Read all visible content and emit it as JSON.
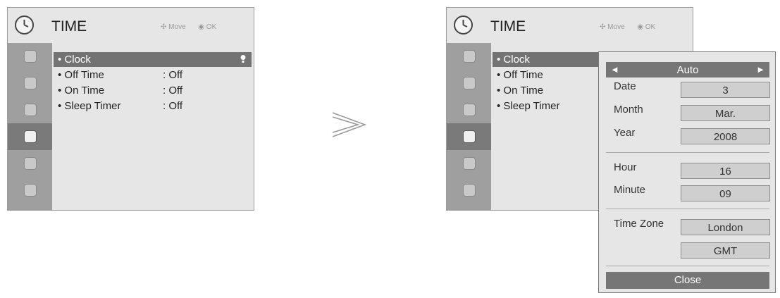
{
  "menu": {
    "title": "TIME",
    "hint_move": "Move",
    "hint_ok": "OK",
    "items": [
      {
        "label": "Clock",
        "value": ""
      },
      {
        "label": "Off Time",
        "value": ": Off"
      },
      {
        "label": "On Time",
        "value": ": Off"
      },
      {
        "label": "Sleep Timer",
        "value": ": Off"
      }
    ],
    "side_tabs": [
      "setup-icon",
      "picture-icon",
      "audio-icon",
      "time-icon",
      "lock-icon",
      "input-icon"
    ],
    "selected_tab": "time-icon",
    "selected_item": "Clock"
  },
  "clock_popup": {
    "mode_left": "◄",
    "mode": "Auto",
    "mode_right": "►",
    "fields": [
      {
        "label": "Date",
        "value": "3"
      },
      {
        "label": "Month",
        "value": "Mar."
      },
      {
        "label": "Year",
        "value": "2008"
      },
      {
        "label": "Hour",
        "value": "16"
      },
      {
        "label": "Minute",
        "value": "09"
      },
      {
        "label": "Time Zone",
        "value": "London"
      },
      {
        "label": "",
        "value": "GMT"
      }
    ],
    "close_label": "Close"
  },
  "colors": {
    "panel_bg": "#e6e6e6",
    "sidebar": "#9f9f9f",
    "highlight": "#737373",
    "text": "#222222"
  }
}
